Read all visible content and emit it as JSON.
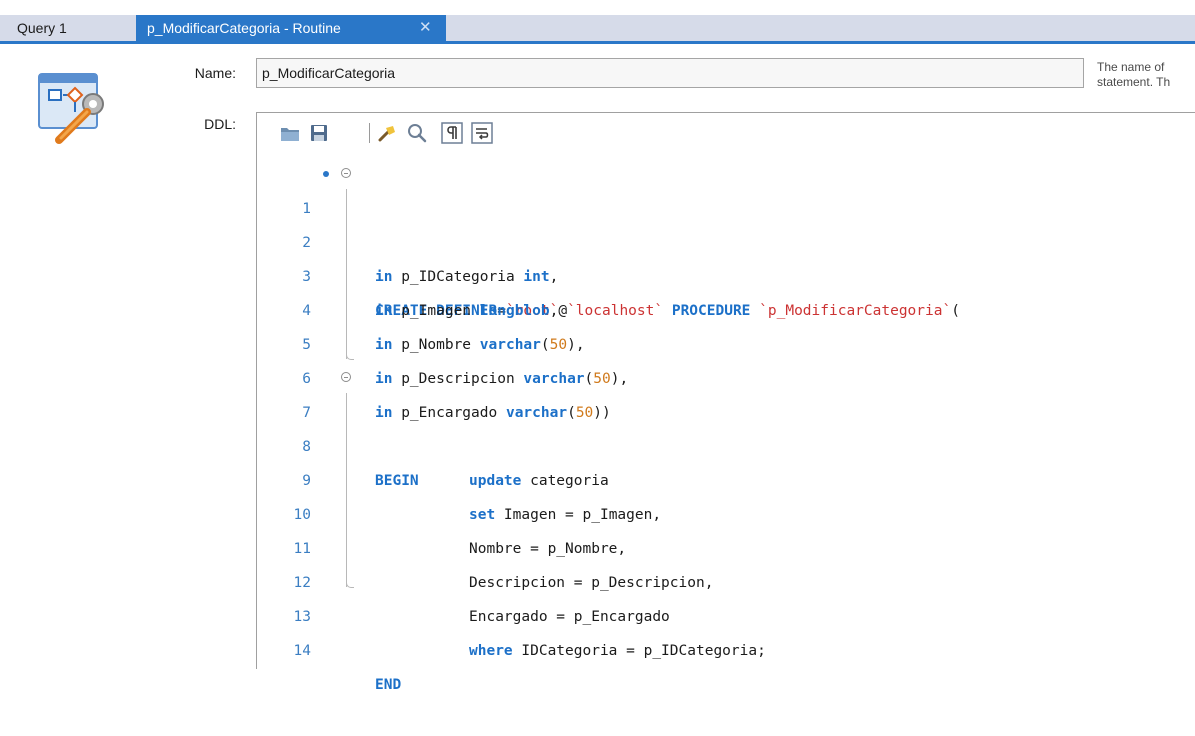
{
  "tabs": [
    {
      "label": "Query 1"
    },
    {
      "label": "p_ModificarCategoria - Routine",
      "close_glyph": "✕"
    }
  ],
  "form": {
    "name_label": "Name:",
    "name_value": "p_ModificarCategoria",
    "ddl_label": "DDL:",
    "hint_line1": "The name of",
    "hint_line2": "statement. Th"
  },
  "toolbar_icons": [
    "open-file-icon",
    "save-icon",
    "beautify-icon",
    "find-icon",
    "invisible-chars-icon",
    "word-wrap-icon"
  ],
  "colors": {
    "accent": "#2a77c8",
    "keyword": "#1c70c8",
    "string": "#cc3333",
    "number": "#d07a1c"
  },
  "code": {
    "line_numbers": [
      "1",
      "2",
      "3",
      "4",
      "5",
      "6",
      "7",
      "8",
      "9",
      "10",
      "11",
      "12",
      "13",
      "14"
    ],
    "l1": {
      "kw1": "CREATE DEFINER",
      "t1": "=",
      "s1": "`root`",
      "t2": "@",
      "s2": "`localhost`",
      "t3": " ",
      "kw2": "PROCEDURE",
      "t4": " ",
      "s3": "`p_ModificarCategoria`",
      "t5": "("
    },
    "l2": {
      "kw1": "in",
      "t1": " p_IDCategoria ",
      "kw2": "int",
      "t2": ","
    },
    "l3": {
      "kw1": "in",
      "t1": " p_Imagen ",
      "kw2": "longblob",
      "t2": ","
    },
    "l4": {
      "kw1": "in",
      "t1": " p_Nombre ",
      "kw2": "varchar",
      "t2": "(",
      "n1": "50",
      "t3": "),"
    },
    "l5": {
      "kw1": "in",
      "t1": " p_Descripcion ",
      "kw2": "varchar",
      "t2": "(",
      "n1": "50",
      "t3": "),"
    },
    "l6": {
      "kw1": "in",
      "t1": " p_Encargado ",
      "kw2": "varchar",
      "t2": "(",
      "n1": "50",
      "t3": "))"
    },
    "l7": {
      "kw1": "BEGIN"
    },
    "l8": {
      "kw1": "update",
      "t1": " categoria"
    },
    "l9": {
      "kw1": "set",
      "t1": " Imagen = p_Imagen,"
    },
    "l10": {
      "t1": "Nombre = p_Nombre,"
    },
    "l11": {
      "t1": "Descripcion = p_Descripcion,"
    },
    "l12": {
      "t1": "Encargado = p_Encargado"
    },
    "l13": {
      "kw1": "where",
      "t1": " IDCategoria = p_IDCategoria;"
    },
    "l14": {
      "kw1": "END"
    }
  }
}
